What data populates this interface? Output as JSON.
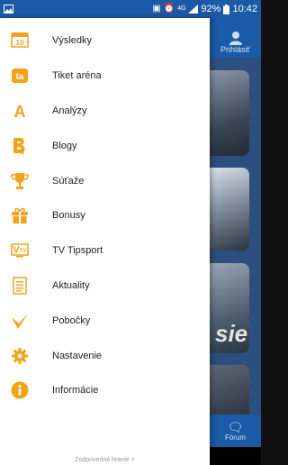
{
  "status_bar": {
    "network": "4G",
    "battery": "92%",
    "time": "10:42"
  },
  "app": {
    "login_label": "Prihlásiť",
    "tile_text": "sie",
    "footer_label": "Fórum"
  },
  "menu": {
    "items": [
      {
        "label": "Výsledky",
        "icon": "results-icon"
      },
      {
        "label": "Tiket aréna",
        "icon": "ticket-arena-icon"
      },
      {
        "label": "Analýzy",
        "icon": "analyses-icon"
      },
      {
        "label": "Blogy",
        "icon": "blog-icon"
      },
      {
        "label": "Súťaže",
        "icon": "trophy-icon"
      },
      {
        "label": "Bonusy",
        "icon": "gift-icon"
      },
      {
        "label": "TV Tipsport",
        "icon": "tv-icon"
      },
      {
        "label": "Aktuality",
        "icon": "news-icon"
      },
      {
        "label": "Pobočky",
        "icon": "branch-icon"
      },
      {
        "label": "Nastavenie",
        "icon": "gear-icon"
      },
      {
        "label": "Informácie",
        "icon": "info-icon"
      }
    ],
    "results_icon_text": "10",
    "ticket_icon_text": "ta",
    "analyses_icon_text": "A",
    "tv_icon_text": "TV"
  },
  "footer": {
    "responsible_gaming": "Zodpovedné hranie >"
  },
  "colors": {
    "accent": "#f4a21a",
    "brand": "#1a5aa6"
  }
}
